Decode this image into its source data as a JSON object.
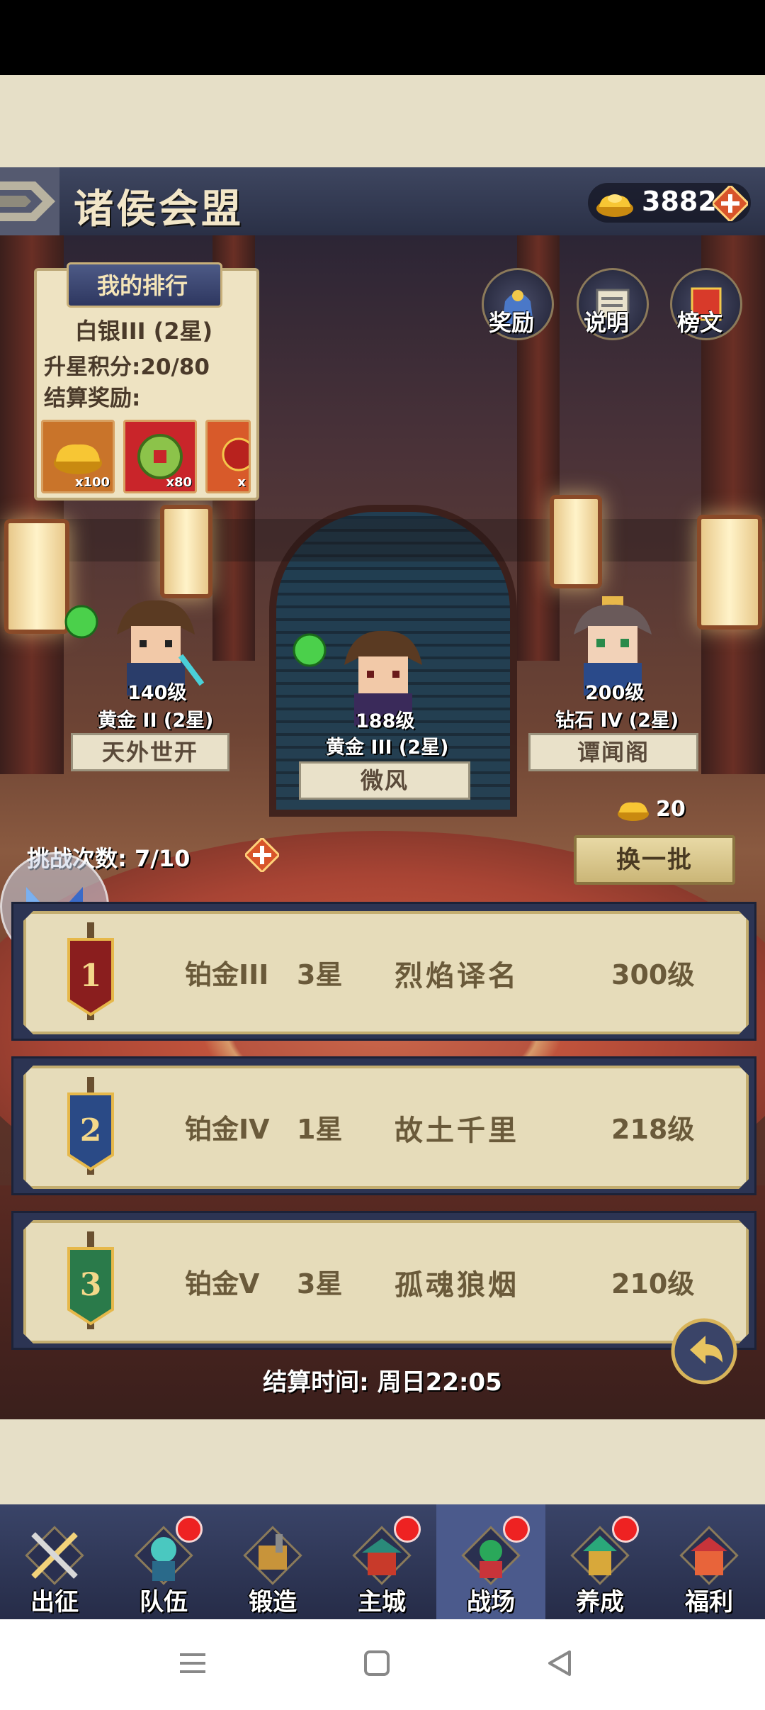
{
  "header": {
    "title": "诸侯会盟",
    "gold": "3882"
  },
  "my_rank": {
    "tab_label": "我的排行",
    "tier": "白银III (2星)",
    "points": "升星积分:20/80",
    "reward_label": "结算奖励:",
    "rewards": [
      {
        "icon": "gold-ingot-icon",
        "count": "x100"
      },
      {
        "icon": "jade-coin-icon",
        "count": "x80"
      },
      {
        "icon": "red-item-icon",
        "count": "x"
      }
    ]
  },
  "side_buttons": [
    {
      "icon": "reward-bag-icon",
      "label": "奖励"
    },
    {
      "icon": "scroll-icon",
      "label": "说明"
    },
    {
      "icon": "banner-icon",
      "label": "榜文"
    }
  ],
  "opponents": [
    {
      "level": "140级",
      "tier": "黄金 II (2星)",
      "name": "天外世开"
    },
    {
      "level": "188级",
      "tier": "黄金 III (2星)",
      "name": "微风"
    },
    {
      "level": "200级",
      "tier": "钻石 IV (2星)",
      "name": "谭闻阁"
    }
  ],
  "refresh": {
    "cost": "20",
    "label": "换一批"
  },
  "challenge": {
    "label": "挑战次数: 7/10"
  },
  "leaderboard": [
    {
      "rank": "1",
      "tier": "铂金III",
      "stars": "3星",
      "name": "烈焰译名",
      "level": "300级",
      "color": "#8a1e1e"
    },
    {
      "rank": "2",
      "tier": "铂金IV",
      "stars": "1星",
      "name": "故土千里",
      "level": "218级",
      "color": "#2a4a86"
    },
    {
      "rank": "3",
      "tier": "铂金Ⅴ",
      "stars": "3星",
      "name": "孤魂狼烟",
      "level": "210级",
      "color": "#2a7a4a"
    }
  ],
  "settle_time": "结算时间: 周日22:05",
  "nav": [
    {
      "label": "出征",
      "icon": "crossed-swords-icon",
      "badge": false,
      "active": false
    },
    {
      "label": "队伍",
      "icon": "warrior-icon",
      "badge": true,
      "active": false
    },
    {
      "label": "锻造",
      "icon": "forge-icon",
      "badge": false,
      "active": false
    },
    {
      "label": "主城",
      "icon": "city-icon",
      "badge": true,
      "active": false
    },
    {
      "label": "战场",
      "icon": "battlefield-icon",
      "badge": true,
      "active": true
    },
    {
      "label": "养成",
      "icon": "pagoda-icon",
      "badge": true,
      "active": false
    },
    {
      "label": "福利",
      "icon": "gift-hall-icon",
      "badge": false,
      "active": false
    }
  ],
  "colors": {
    "accent": "#2a3046",
    "panel": "#e6dcba",
    "badge": "#e22222"
  }
}
